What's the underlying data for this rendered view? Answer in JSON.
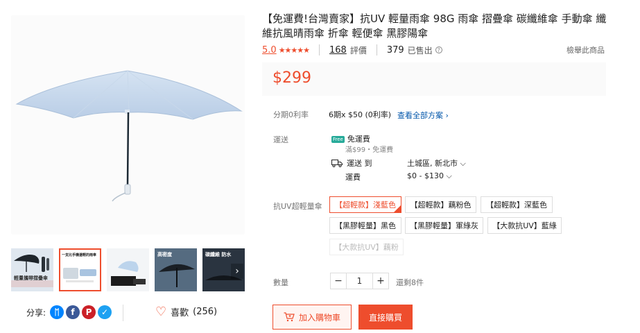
{
  "product": {
    "title": "【免運費!台灣賣家】抗UV 輕量雨傘 98G 雨傘 摺疊傘 碳纖維傘 手動傘 纖維抗風晴雨傘 折傘 輕便傘 黑膠陽傘",
    "rating": "5.0",
    "stars": "★★★★★",
    "reviews_count": "168",
    "reviews_label": "評價",
    "sold_count": "379",
    "sold_label": "已售出",
    "report_label": "檢舉此商品",
    "price": "$299"
  },
  "installment": {
    "label": "分期0利率",
    "value": "6期x $50 (0利率)",
    "link": "查看全部方案 ›"
  },
  "shipping": {
    "label": "運送",
    "free_badge": "Free",
    "free_title": "免運費",
    "free_note": "滿$99・免運費",
    "to_label": "運送 到",
    "to_value": "土城區, 新北市 ⌵",
    "fee_label": "運費",
    "fee_value": "$0 - $130 ⌵"
  },
  "variant": {
    "label": "抗UV超輕量傘",
    "options": [
      "【超輕款】淺藍色",
      "【超輕款】藕粉色",
      "【超輕款】深藍色",
      "【黑膠輕量】黑色",
      "【黑膠輕量】軍綠灰",
      "【大款抗UV】藍綠",
      "【大款抗UV】藕粉"
    ],
    "selected_index": 0
  },
  "quantity": {
    "label": "數量",
    "minus": "−",
    "value": "1",
    "plus": "+",
    "stock": "還剩8件"
  },
  "actions": {
    "add_to_cart": "加入購物車",
    "buy_now": "直接購買"
  },
  "share": {
    "label": "分享:",
    "icons": [
      "messenger-icon",
      "facebook-icon",
      "pinterest-icon",
      "twitter-icon"
    ],
    "messenger_glyph": "ᛖ",
    "facebook_glyph": "f",
    "pinterest_glyph": "P",
    "twitter_glyph": "✓"
  },
  "like": {
    "label": "喜歡",
    "count": "(256)"
  },
  "thumbnails": {
    "thumb1_caption": "輕量攜帶摺疊傘",
    "thumb2_caption": "一支比手機還輕的雨傘",
    "thumb4_caption": "高密度",
    "thumb5_caption": "碳纖維 防水"
  },
  "colors": {
    "accent": "#ee4d2d",
    "link": "#0055aa",
    "free_green": "#26aa99",
    "messenger": "#0084ff",
    "facebook": "#3b5998",
    "pinterest": "#cb2027",
    "twitter": "#1da1f2"
  }
}
